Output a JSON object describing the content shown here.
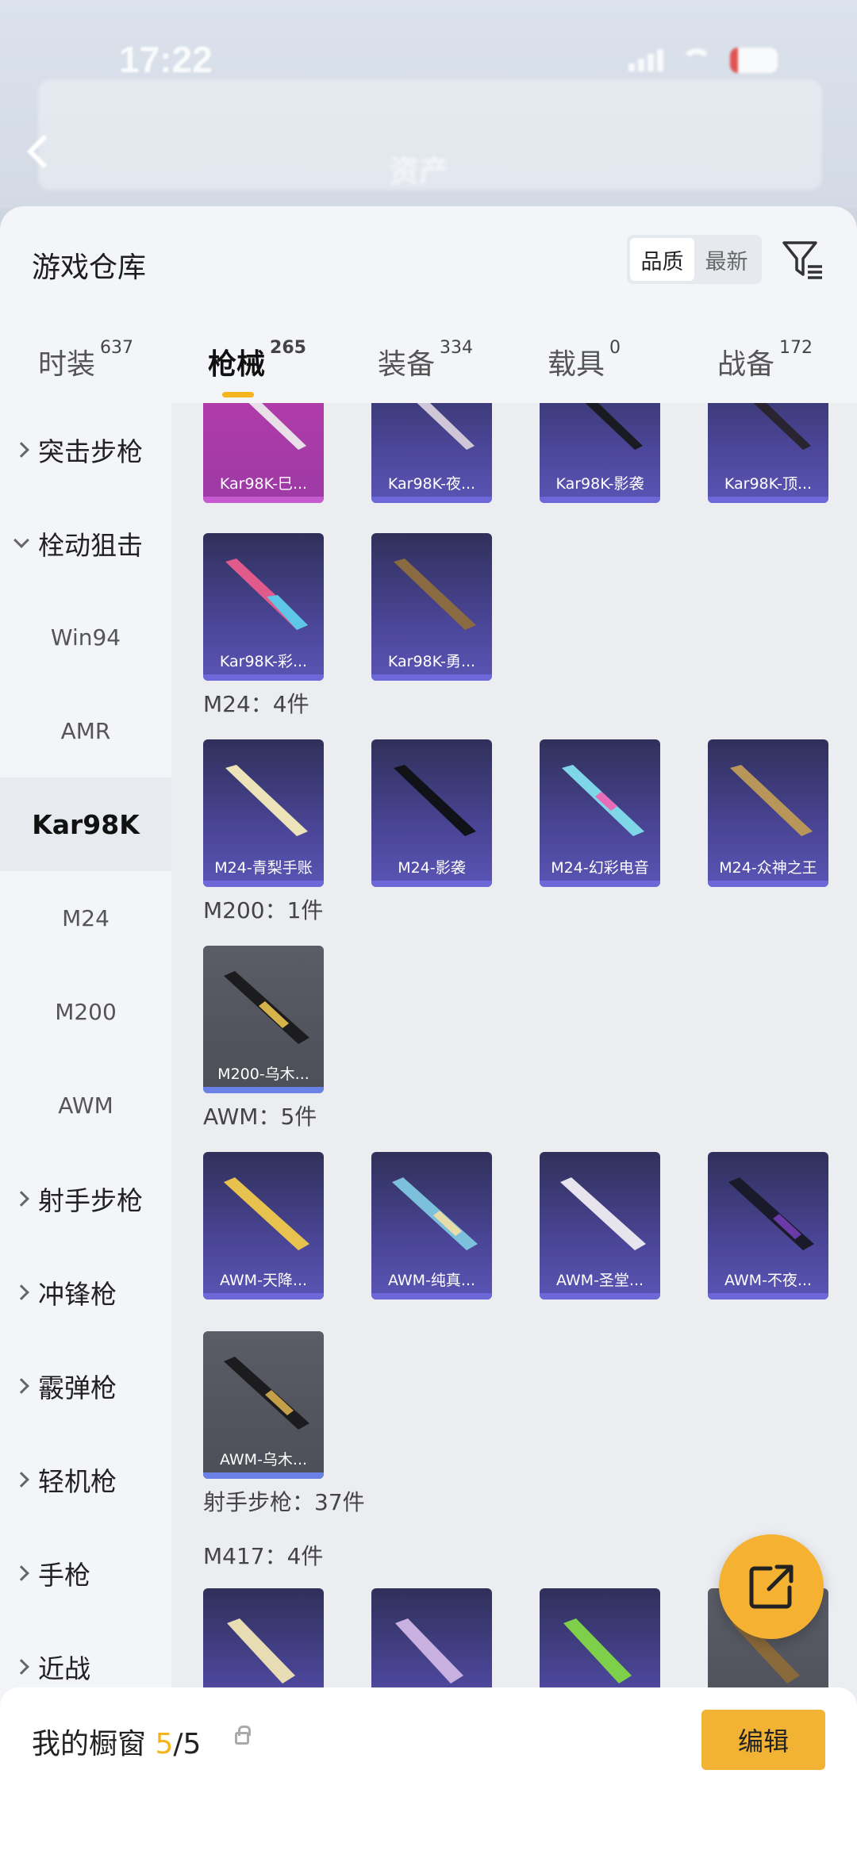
{
  "status": {
    "time": "17:22"
  },
  "nav": {
    "title": "资产"
  },
  "sheet": {
    "title": "游戏仓库",
    "sort": [
      "品质",
      "最新"
    ]
  },
  "tabs": [
    {
      "label": "时装",
      "count": "637"
    },
    {
      "label": "枪械",
      "count": "265"
    },
    {
      "label": "装备",
      "count": "334"
    },
    {
      "label": "载具",
      "count": "0"
    },
    {
      "label": "战备",
      "count": "172"
    }
  ],
  "sidebar": [
    {
      "label": "突击步枪"
    },
    {
      "label": "栓动狙击"
    },
    {
      "label": "Win94"
    },
    {
      "label": "AMR"
    },
    {
      "label": "Kar98K"
    },
    {
      "label": "M24"
    },
    {
      "label": "M200"
    },
    {
      "label": "AWM"
    },
    {
      "label": "射手步枪"
    },
    {
      "label": "冲锋枪"
    },
    {
      "label": "霰弹枪"
    },
    {
      "label": "轻机枪"
    },
    {
      "label": "手枪"
    },
    {
      "label": "近战"
    }
  ],
  "cards": [
    {
      "name": "Kar98K-巳..."
    },
    {
      "name": "Kar98K-夜..."
    },
    {
      "name": "Kar98K-影袭"
    },
    {
      "name": "Kar98K-顶..."
    },
    {
      "name": "Kar98K-彩..."
    },
    {
      "name": "Kar98K-勇..."
    },
    {
      "name": "M24-青梨手账"
    },
    {
      "name": "M24-影袭"
    },
    {
      "name": "M24-幻彩电音"
    },
    {
      "name": "M24-众神之王"
    },
    {
      "name": "M200-乌木..."
    },
    {
      "name": "AWM-天降..."
    },
    {
      "name": "AWM-纯真..."
    },
    {
      "name": "AWM-圣堂..."
    },
    {
      "name": "AWM-不夜..."
    },
    {
      "name": "AWM-乌木..."
    }
  ],
  "groups": [
    {
      "label": "M24：4件"
    },
    {
      "label": "M200：1件"
    },
    {
      "label": "AWM：5件"
    },
    {
      "label": "射手步枪：37件"
    },
    {
      "label": "M417：4件"
    }
  ],
  "bottom": {
    "label": "我的橱窗",
    "count": "5",
    "total": "/5",
    "edit": "编辑"
  },
  "colors": {
    "accent": "#f5b31c",
    "card": "#4a4596"
  },
  "icons": [
    "back-icon",
    "filter-icon",
    "lock-icon",
    "share-icon",
    "chevron-right-icon",
    "chevron-down-icon"
  ]
}
